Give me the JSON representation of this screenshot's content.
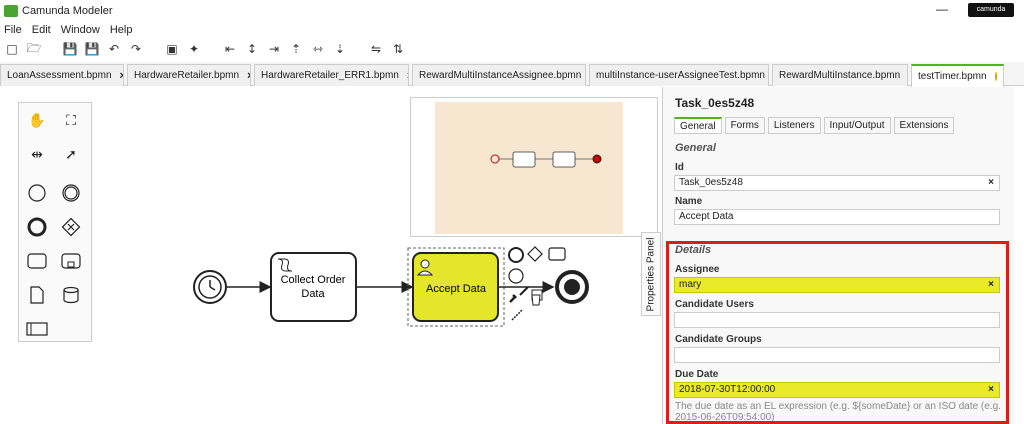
{
  "app": {
    "title": "Camunda Modeler",
    "minimize": "—",
    "brand": "camunda"
  },
  "menu": [
    "File",
    "Edit",
    "Window",
    "Help"
  ],
  "tabs": [
    {
      "label": "LoanAssessment.bpmn",
      "close": "×"
    },
    {
      "label": "HardwareRetailer.bpmn",
      "close": "×"
    },
    {
      "label": "HardwareRetailer_ERR1.bpmn",
      "close": "×"
    },
    {
      "label": "RewardMultiInstanceAssignee.bpmn",
      "close": "×"
    },
    {
      "label": "multiInstance-userAssigneeTest.bpmn",
      "close": "×"
    },
    {
      "label": "RewardMultiInstance.bpmn",
      "close": "×"
    },
    {
      "label": "testTimer.bpmn",
      "active": true
    }
  ],
  "diagram": {
    "task1": "Collect Order Data",
    "task2": "Accept Data",
    "accent": "#e3e62a"
  },
  "properties_tab": "Properties Panel",
  "panel": {
    "title": "Task_0es5z48",
    "tabs": [
      "General",
      "Forms",
      "Listeners",
      "Input/Output",
      "Extensions"
    ],
    "general_title": "General",
    "id_label": "Id",
    "id_value": "Task_0es5z48",
    "name_label": "Name",
    "name_value": "Accept Data",
    "details_title": "Details",
    "assignee_label": "Assignee",
    "assignee_value": "mary",
    "cand_users_label": "Candidate Users",
    "cand_users_value": "",
    "cand_groups_label": "Candidate Groups",
    "cand_groups_value": "",
    "due_label": "Due Date",
    "due_value": "2018-07-30T12:00:00",
    "due_hint": "The due date as an EL expression (e.g. ${someDate} or an ISO date (e.g. 2015-06-26T09:54:00)",
    "clear": "×"
  }
}
